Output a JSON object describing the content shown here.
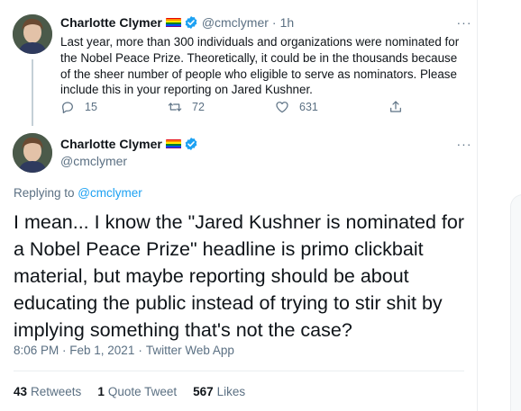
{
  "tweet1": {
    "display_name": "Charlotte Clymer",
    "handle": "@cmclymer",
    "separator": "·",
    "time": "1h",
    "more": "···",
    "text": "Last year, more than 300 individuals and organizations were nominated for the Nobel Peace Prize. Theoretically, it could be in the thousands because of the sheer number of people who eligible to serve as nominators. Please include this in your reporting on Jared Kushner.",
    "actions": {
      "replies": "15",
      "retweets": "72",
      "likes": "631"
    }
  },
  "tweet2": {
    "display_name": "Charlotte Clymer",
    "handle": "@cmclymer",
    "more": "···",
    "replying_prefix": "Replying to ",
    "replying_to": "@cmclymer",
    "text": "I mean... I know the \"Jared Kushner is nominated for a Nobel Peace Prize\" headline is primo clickbait material, but maybe reporting should be about educating the public instead of trying to stir shit by implying something that's not the case?",
    "timestamp": "8:06 PM · Feb 1, 2021",
    "meta_sep": "·",
    "source": "Twitter Web App",
    "stats": {
      "retweets_count": "43",
      "retweets_label": "Retweets",
      "quotes_count": "1",
      "quotes_label": "Quote Tweet",
      "likes_count": "567",
      "likes_label": "Likes"
    }
  },
  "colors": {
    "accent": "#1da1f2",
    "secondary_text": "#5b7083",
    "primary_text": "#0f1419",
    "border": "#ebeef0"
  },
  "icons": [
    "more-icon",
    "reply-icon",
    "retweet-icon",
    "like-icon",
    "share-icon",
    "verified-icon",
    "rainbow-flag-icon"
  ]
}
